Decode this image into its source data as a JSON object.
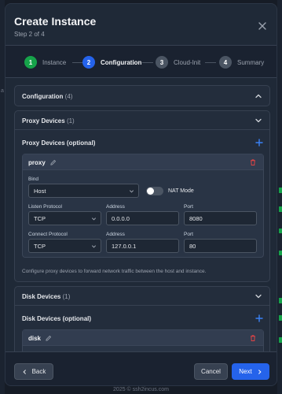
{
  "modal": {
    "title": "Create Instance",
    "subtitle": "Step 2 of 4"
  },
  "steps": [
    {
      "number": "1",
      "label": "Instance",
      "state": "completed",
      "color": "#16a34a"
    },
    {
      "number": "2",
      "label": "Configuration",
      "state": "active",
      "color": "#2563eb"
    },
    {
      "number": "3",
      "label": "Cloud-Init",
      "state": "pending",
      "color": "#4b5563"
    },
    {
      "number": "4",
      "label": "Summary",
      "state": "pending",
      "color": "#4b5563"
    }
  ],
  "configuration": {
    "title": "Configuration",
    "count": "(4)"
  },
  "proxy_devices": {
    "title": "Proxy Devices",
    "count": "(1)",
    "subheading": "Proxy Devices (optional)",
    "device": {
      "name": "proxy",
      "bind_label": "Bind",
      "bind_value": "Host",
      "nat_label": "NAT Mode",
      "nat_enabled": false,
      "listen_protocol_label": "Listen Protocol",
      "listen_protocol": "TCP",
      "listen_address_label": "Address",
      "listen_address": "0.0.0.0",
      "listen_port_label": "Port",
      "listen_port": "8080",
      "connect_protocol_label": "Connect Protocol",
      "connect_protocol": "TCP",
      "connect_address_label": "Address",
      "connect_address": "127.0.0.1",
      "connect_port_label": "Port",
      "connect_port": "80"
    },
    "help": "Configure proxy devices to forward network traffic between the host and instance."
  },
  "disk_devices": {
    "title": "Disk Devices",
    "count": "(1)",
    "subheading": "Disk Devices (optional)",
    "device": {
      "name": "disk"
    }
  },
  "footer": {
    "back_label": "Back",
    "cancel_label": "Cancel",
    "next_label": "Next",
    "copyright": "2025 © ssh2incus.com"
  },
  "background": {
    "left_char": "a"
  },
  "colors": {
    "accent": "#2563eb",
    "success": "#16a34a",
    "danger": "#ef4444",
    "plus": "#3b82f6"
  }
}
